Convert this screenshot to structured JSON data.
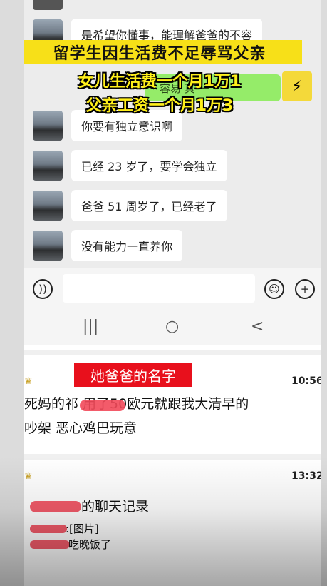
{
  "chat": {
    "partial_message": "是希望你懂事，能理解爸爸的不容",
    "green_message_fragment": "容易 真 一",
    "messages": [
      {
        "text": "你要有独立意识啊"
      },
      {
        "text": "已经 23 岁了，要学会独立"
      },
      {
        "text": "爸爸 51 周岁了，已经老了"
      },
      {
        "text": "没有能力一直养你"
      }
    ]
  },
  "overlay": {
    "title": "留学生因生活费不足辱骂父亲",
    "caption_1": "女儿生活费一个月1万1",
    "caption_2": "父亲工资一个月1万3"
  },
  "input": {
    "voice_icon": "voice-icon",
    "emoji_icon": "emoji-icon",
    "plus_icon": "plus-icon"
  },
  "nav": {
    "recent": "|||",
    "home": "○",
    "back": "<"
  },
  "post1": {
    "tag": "她爸爸的名字",
    "time": "10:56",
    "line1": "死妈的祁        用了50欧元就跟我大清早的",
    "line2": "吵架 恶心鸡巴玩意"
  },
  "post2": {
    "time": "13:32",
    "title": "的聊天记录",
    "line1": ":[图片]",
    "line2": "吃晚饭了"
  }
}
